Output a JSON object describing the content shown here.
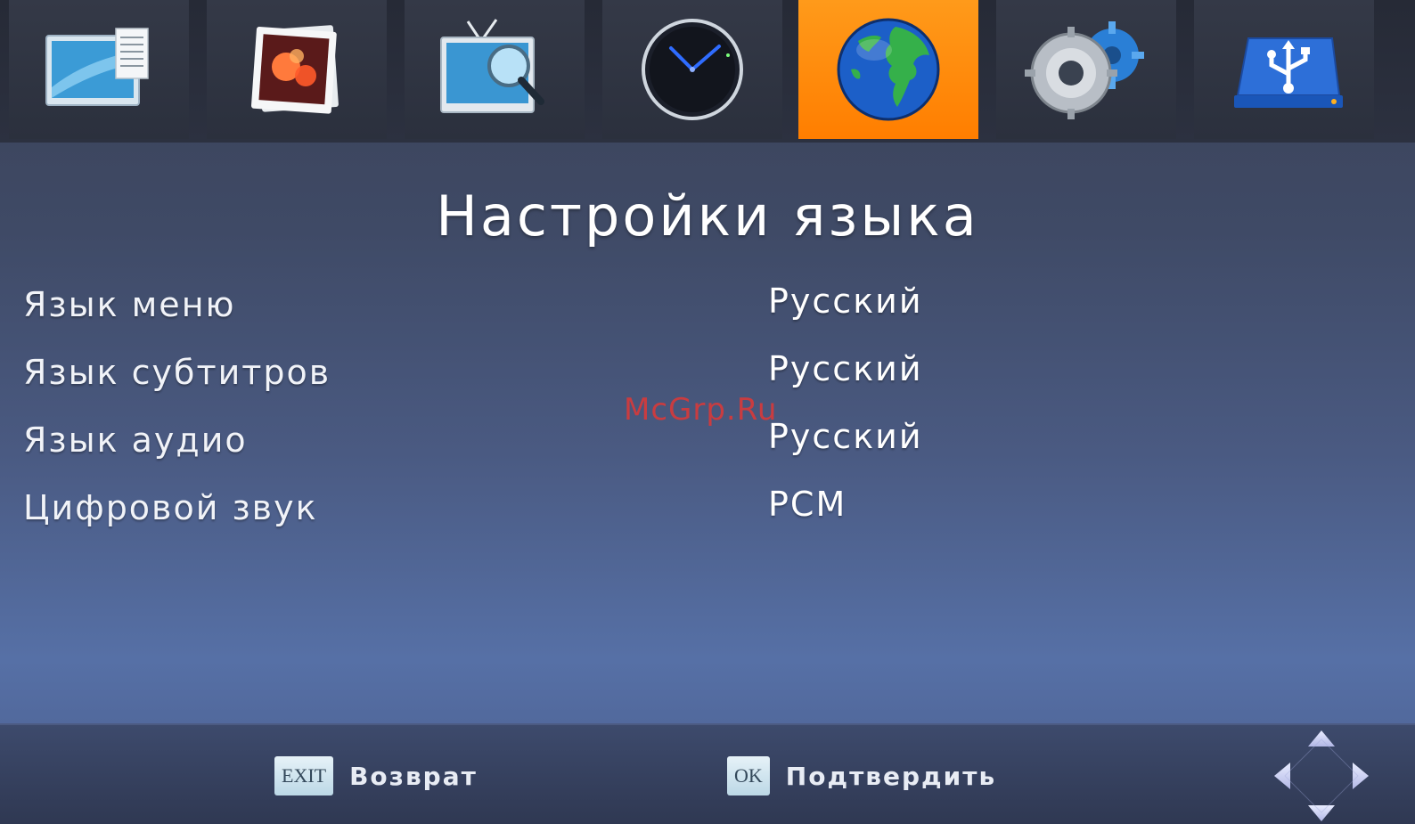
{
  "topbar": {
    "items": [
      {
        "name": "program-icon"
      },
      {
        "name": "picture-icon"
      },
      {
        "name": "channel-search-icon"
      },
      {
        "name": "time-icon"
      },
      {
        "name": "language-globe-icon"
      },
      {
        "name": "system-settings-icon"
      },
      {
        "name": "usb-icon"
      }
    ],
    "active_index": 4
  },
  "page": {
    "title": "Настройки языка"
  },
  "settings": [
    {
      "label": "Язык меню",
      "value": "Русский"
    },
    {
      "label": "Язык субтитров",
      "value": "Русский"
    },
    {
      "label": "Язык аудио",
      "value": "Русский"
    },
    {
      "label": "Цифровой звук",
      "value": "PCM"
    }
  ],
  "watermark": "McGrp.Ru",
  "footer": {
    "exit_key": "EXIT",
    "exit_label": "Возврат",
    "ok_key": "OK",
    "ok_label": "Подтвердить"
  },
  "colors": {
    "active_tile": "#ff8a00",
    "watermark": "#d83a3a"
  }
}
